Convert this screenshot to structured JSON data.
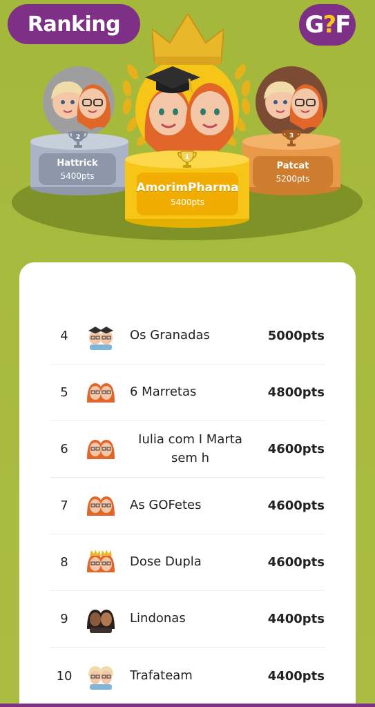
{
  "header": {
    "title": "Ranking",
    "logo_text_a": "G",
    "logo_text_q": "?",
    "logo_text_b": "F"
  },
  "podium": {
    "first": {
      "rank": "1",
      "team": "AmorimPharma",
      "pts": "5400pts"
    },
    "second": {
      "rank": "2",
      "team": "Hattrick",
      "pts": "5400pts"
    },
    "third": {
      "rank": "3",
      "team": "Patcat",
      "pts": "5200pts"
    }
  },
  "ranking": [
    {
      "rank": "4",
      "team": "Os Granadas",
      "pts": "5000pts",
      "avatar": "graduates"
    },
    {
      "rank": "5",
      "team": "6 Marretas",
      "pts": "4800pts",
      "avatar": "redheads"
    },
    {
      "rank": "6",
      "team": "Iulia com I Marta sem h",
      "pts": "4600pts",
      "avatar": "redheads"
    },
    {
      "rank": "7",
      "team": "As GOFetes",
      "pts": "4600pts",
      "avatar": "redheads"
    },
    {
      "rank": "8",
      "team": "Dose Dupla",
      "pts": "4600pts",
      "avatar": "crowned"
    },
    {
      "rank": "9",
      "team": "Lindonas",
      "pts": "4400pts",
      "avatar": "dark"
    },
    {
      "rank": "10",
      "team": "Trafateam",
      "pts": "4400pts",
      "avatar": "blondes"
    }
  ],
  "colors": {
    "brand": "#7e2f86",
    "background": "#a8bb3f",
    "gold": "#f6c518",
    "silver": "#aab4c6",
    "bronze": "#e99a48"
  }
}
